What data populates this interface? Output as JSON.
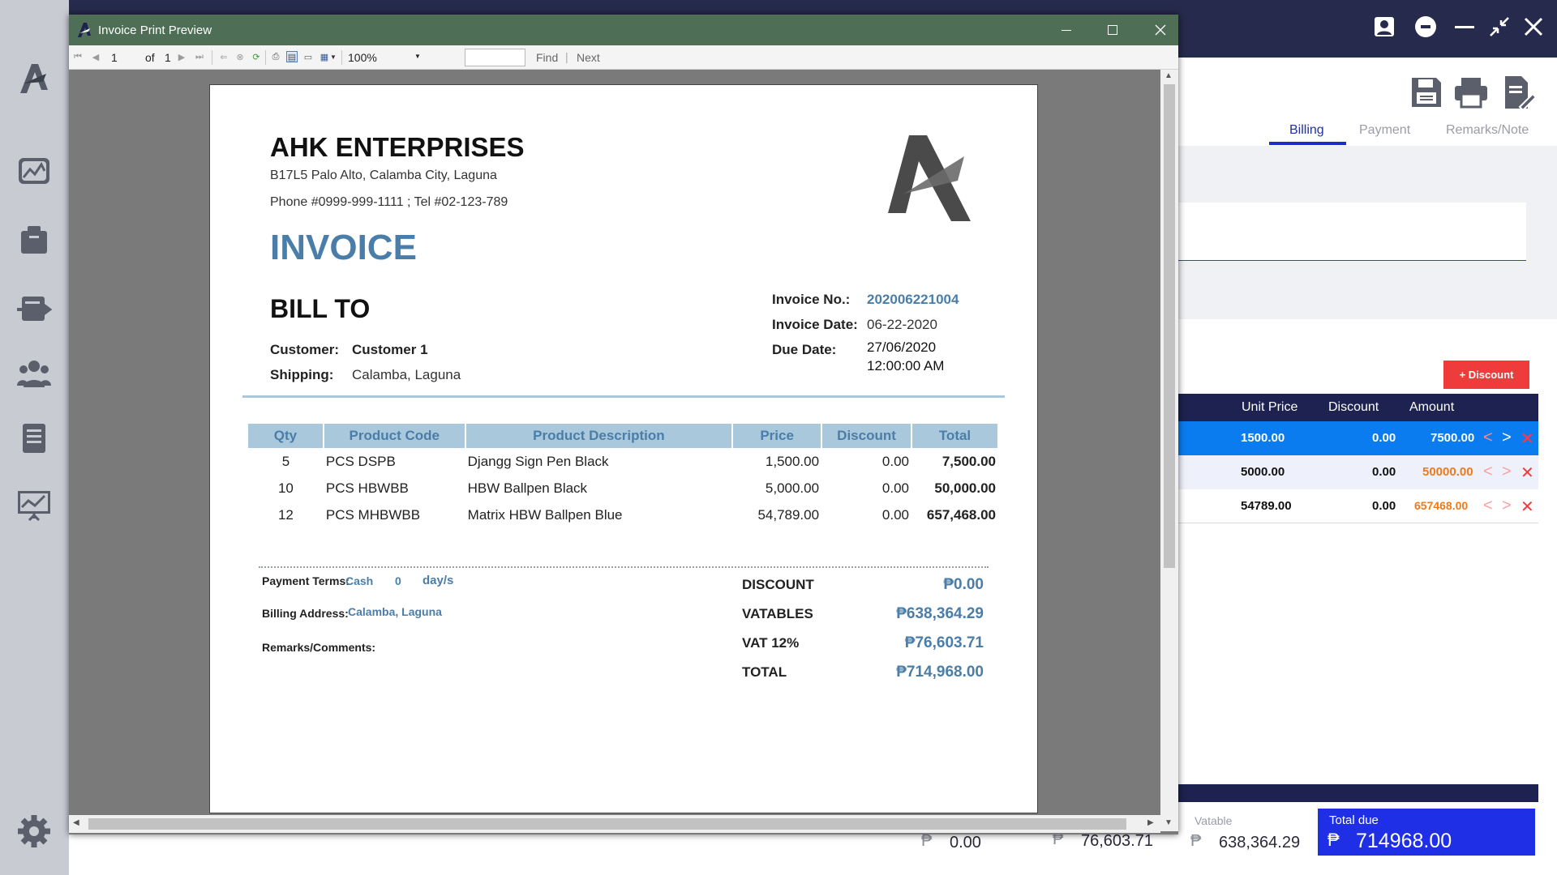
{
  "window": {
    "title": "Invoice Print Preview"
  },
  "toolbar": {
    "page_current": "1",
    "page_of": "of",
    "page_total": "1",
    "zoom": "100%",
    "search_value": "",
    "find": "Find",
    "next": "Next",
    "separator": "|"
  },
  "invoice": {
    "company_name": "AHK ENTERPRISES",
    "address": "B17L5 Palo Alto, Calamba City, Laguna",
    "phone": "Phone #0999-999-1111 ; Tel #02-123-789",
    "title": "INVOICE",
    "bill_to": "BILL TO",
    "customer_label": "Customer:",
    "customer_value": "Customer 1",
    "shipping_label": "Shipping:",
    "shipping_value": "Calamba, Laguna",
    "invoice_no_label": "Invoice No.:",
    "invoice_no_value": "202006221004",
    "invoice_date_label": "Invoice Date:",
    "invoice_date_value": "06-22-2020",
    "due_date_label": "Due Date:",
    "due_date_value": "27/06/2020",
    "due_time_value": "12:00:00 AM",
    "table_headers": [
      "Qty",
      "Product Code",
      "Product Description",
      "Price",
      "Discount",
      "Total"
    ],
    "items": [
      {
        "qty": "5",
        "code": "PCS DSPB",
        "desc": "Djangg Sign Pen Black",
        "price": "1,500.00",
        "discount": "0.00",
        "total": "7,500.00"
      },
      {
        "qty": "10",
        "code": "PCS HBWBB",
        "desc": "HBW Ballpen Black",
        "price": "5,000.00",
        "discount": "0.00",
        "total": "50,000.00"
      },
      {
        "qty": "12",
        "code": "PCS MHBWBB",
        "desc": "Matrix HBW Ballpen Blue",
        "price": "54,789.00",
        "discount": "0.00",
        "total": "657,468.00"
      }
    ],
    "payment_terms_label": "Payment Terms:",
    "payment_terms_value": "Cash",
    "payment_days": "0",
    "payment_days_unit": "day/s",
    "billing_address_label": "Billing Address:",
    "billing_address_value": "Calamba, Laguna",
    "remarks_label": "Remarks/Comments:",
    "discount_label": "DISCOUNT",
    "discount_value": "₱0.00",
    "vatables_label": "VATABLES",
    "vatables_value": "₱638,364.29",
    "vat_label": "VAT 12%",
    "vat_value": "₱76,603.71",
    "total_label": "TOTAL",
    "total_value": "₱714,968.00"
  },
  "right_panel": {
    "tabs": [
      "Billing",
      "Payment",
      "Remarks/Note"
    ],
    "discount_button": "+ Discount",
    "grid_headers": [
      "Unit Price",
      "Discount",
      "Amount"
    ],
    "rows": [
      {
        "unit_price": "1500.00",
        "discount": "0.00",
        "amount": "7500.00"
      },
      {
        "unit_price": "5000.00",
        "discount": "0.00",
        "amount": "50000.00"
      },
      {
        "unit_price": "54789.00",
        "discount": "0.00",
        "amount": "657468.00"
      }
    ],
    "peso": "₱",
    "discount_total": "0.00",
    "vat_total": "76,603.71",
    "vatable_label": "Vatable",
    "vatable_total": "638,364.29",
    "total_due_label": "Total due",
    "total_due_value": "714968.00"
  },
  "colors": {
    "topbar": "#262a4c",
    "sidebar": "#c9cbd3",
    "title_bar": "#4e6e56",
    "accent_blue": "#4a7ea8",
    "total_due_bg": "#1f2fe6",
    "discount_button": "#ef3b3b",
    "amount_orange": "#f07a1a"
  },
  "icons": {
    "sidebar": [
      "app-logo-icon",
      "dashboard-icon",
      "inventory-box-icon",
      "transfer-icon",
      "customers-icon",
      "invoice-list-icon",
      "reports-icon",
      "settings-gear-icon"
    ],
    "topbar": [
      "user-account-icon",
      "logout-icon",
      "minimize-icon",
      "restore-icon",
      "close-icon"
    ],
    "actions": [
      "save-icon",
      "print-icon",
      "edit-document-icon"
    ]
  }
}
